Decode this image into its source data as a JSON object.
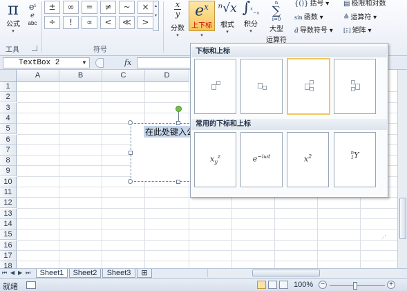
{
  "ribbon": {
    "equation": {
      "glyph": "π",
      "label": "公式"
    },
    "ink": {
      "label": "abc"
    },
    "tools_group_label": "工具",
    "symbols_group_label": "符号",
    "symbols": [
      "±",
      "∞",
      "=",
      "≠",
      "~",
      "×",
      "÷",
      "!",
      "∝",
      "<",
      "≪",
      ">"
    ],
    "fraction": {
      "label": "分数",
      "glyph_top": "x",
      "glyph_bottom": "y"
    },
    "script": {
      "label": "上下标",
      "glyph": "e",
      "sup": "x"
    },
    "radical": {
      "label": "根式",
      "glyph": "ⁿ√x"
    },
    "integral": {
      "label": "积分",
      "glyph": "∫",
      "sup": "x",
      "sub": "−x"
    },
    "large_operator": {
      "label": "大型",
      "label2": "运算符",
      "glyph": "∑",
      "sub": "i=0",
      "sup": "n"
    },
    "bracket": {
      "label": "括号",
      "icon": "{()}"
    },
    "function": {
      "label": "函数",
      "icon": "sin"
    },
    "accent": {
      "label": "导数符号",
      "icon": "ä"
    },
    "limit": {
      "label": "极限和对数"
    },
    "operator": {
      "label": "运算符"
    },
    "matrix": {
      "label": "矩阵"
    }
  },
  "formula_bar": {
    "name_box": "TextBox 2",
    "fx": "fx"
  },
  "columns": [
    "A",
    "B",
    "C",
    "D"
  ],
  "rows": [
    "1",
    "2",
    "3",
    "4",
    "5",
    "6",
    "7",
    "8",
    "9",
    "10",
    "11",
    "12",
    "13",
    "14",
    "15",
    "16",
    "17",
    "18"
  ],
  "textbox": {
    "text": "在此处键入公"
  },
  "dropdown": {
    "section1": "下标和上标",
    "section2": "常用的下标和上标",
    "tiles_row2": [
      {
        "base": "x",
        "sub": "y",
        "sup": "z"
      },
      {
        "base": "e",
        "sup": "−iωt"
      },
      {
        "base": "x",
        "sup": "2"
      },
      {
        "pre_sup": "n",
        "pre_sub": "1",
        "base": "Y"
      }
    ]
  },
  "sheets": [
    "Sheet1",
    "Sheet2",
    "Sheet3"
  ],
  "statusbar": {
    "ready": "就绪",
    "zoom": "100%",
    "zoom_level_percent": 100,
    "minus": "−",
    "plus": "+"
  }
}
